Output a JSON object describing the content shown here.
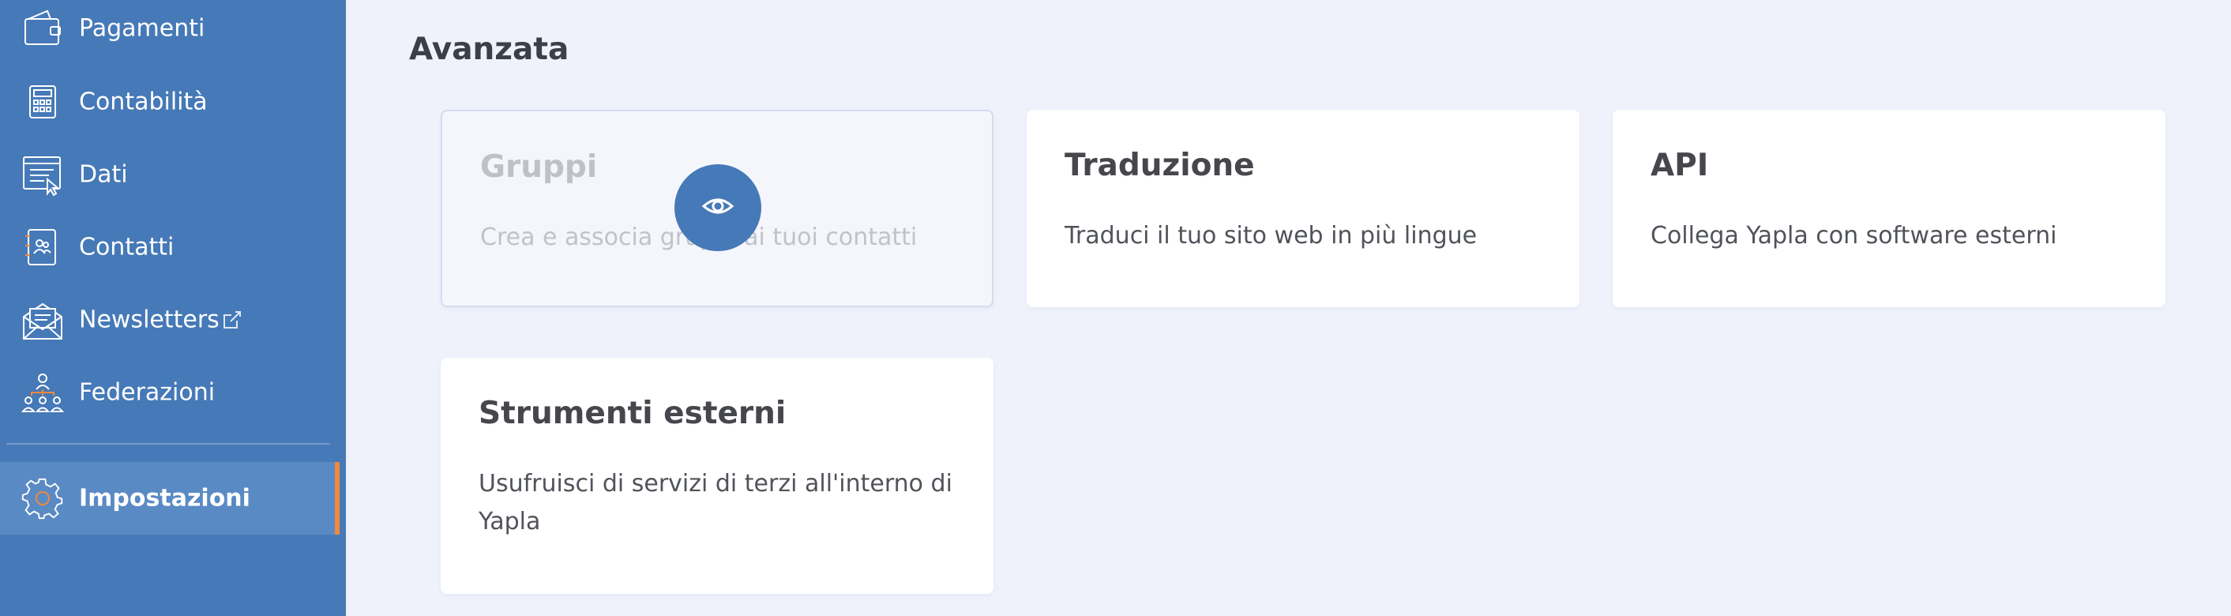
{
  "sidebar": {
    "items": [
      {
        "label": "Pagamenti",
        "icon": "wallet-icon"
      },
      {
        "label": "Contabilità",
        "icon": "calculator-icon"
      },
      {
        "label": "Dati",
        "icon": "data-icon"
      },
      {
        "label": "Contatti",
        "icon": "contacts-book-icon"
      },
      {
        "label": "Newsletters",
        "icon": "envelope-icon",
        "external_icon": "external-link-icon"
      },
      {
        "label": "Federazioni",
        "icon": "federation-icon"
      },
      {
        "label": "Impostazioni",
        "icon": "gear-icon",
        "active": true
      }
    ]
  },
  "main": {
    "section_title": "Avanzata",
    "cards": [
      {
        "title": "Gruppi",
        "description": "Crea e associa gruppi ai tuoi contatti",
        "state": "disabled"
      },
      {
        "title": "Traduzione",
        "description": "Traduci il tuo sito web in più lingue"
      },
      {
        "title": "API",
        "description": "Collega Yapla con software esterni"
      },
      {
        "title": "Strumenti esterni",
        "description": "Usufruisci di servizi di terzi all'interno di Yapla"
      }
    ],
    "overlay_button_icon": "eye-icon"
  },
  "colors": {
    "sidebar_bg": "#4679b7",
    "active_item_bg": "#5a8ac4",
    "active_indicator": "#f08a3c",
    "page_bg": "#eff2fb",
    "card_bg": "#ffffff"
  }
}
